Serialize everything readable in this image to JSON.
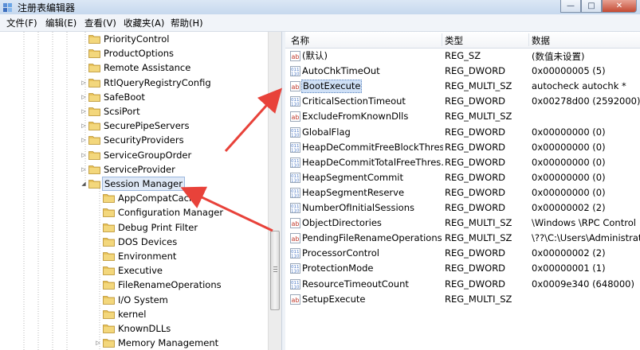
{
  "window": {
    "title": "注册表编辑器",
    "minimize": "—",
    "maximize": "□",
    "close": "✕"
  },
  "menu": [
    "文件(F)",
    "编辑(E)",
    "查看(V)",
    "收藏夹(A)",
    "帮助(H)"
  ],
  "tree": [
    {
      "label": "PriorityControl",
      "has_children": false,
      "level": 1
    },
    {
      "label": "ProductOptions",
      "has_children": false,
      "level": 1
    },
    {
      "label": "Remote Assistance",
      "has_children": false,
      "level": 1
    },
    {
      "label": "RtlQueryRegistryConfig",
      "has_children": true,
      "level": 1
    },
    {
      "label": "SafeBoot",
      "has_children": true,
      "level": 1
    },
    {
      "label": "ScsiPort",
      "has_children": true,
      "level": 1
    },
    {
      "label": "SecurePipeServers",
      "has_children": true,
      "level": 1
    },
    {
      "label": "SecurityProviders",
      "has_children": true,
      "level": 1
    },
    {
      "label": "ServiceGroupOrder",
      "has_children": true,
      "level": 1
    },
    {
      "label": "ServiceProvider",
      "has_children": true,
      "level": 1
    },
    {
      "label": "Session Manager",
      "has_children": true,
      "expanded": true,
      "selected": true,
      "level": 1
    },
    {
      "label": "AppCompatCache",
      "has_children": false,
      "level": 2
    },
    {
      "label": "Configuration Manager",
      "has_children": false,
      "level": 2
    },
    {
      "label": "Debug Print Filter",
      "has_children": false,
      "level": 2
    },
    {
      "label": "DOS Devices",
      "has_children": false,
      "level": 2
    },
    {
      "label": "Environment",
      "has_children": false,
      "level": 2
    },
    {
      "label": "Executive",
      "has_children": false,
      "level": 2
    },
    {
      "label": "FileRenameOperations",
      "has_children": false,
      "level": 2
    },
    {
      "label": "I/O System",
      "has_children": false,
      "level": 2
    },
    {
      "label": "kernel",
      "has_children": false,
      "level": 2
    },
    {
      "label": "KnownDLLs",
      "has_children": false,
      "level": 2
    },
    {
      "label": "Memory Management",
      "has_children": true,
      "level": 2
    }
  ],
  "columns": {
    "name": "名称",
    "type": "类型",
    "data": "数据"
  },
  "values": [
    {
      "name": "(默认)",
      "type": "REG_SZ",
      "data": "(数值未设置)",
      "icon": "string-value-icon"
    },
    {
      "name": "AutoChkTimeOut",
      "type": "REG_DWORD",
      "data": "0x00000005 (5)",
      "icon": "binary-value-icon"
    },
    {
      "name": "BootExecute",
      "type": "REG_MULTI_SZ",
      "data": "autocheck autochk *",
      "icon": "string-value-icon",
      "selected": true
    },
    {
      "name": "CriticalSectionTimeout",
      "type": "REG_DWORD",
      "data": "0x00278d00 (2592000)",
      "icon": "binary-value-icon"
    },
    {
      "name": "ExcludeFromKnownDlls",
      "type": "REG_MULTI_SZ",
      "data": "",
      "icon": "string-value-icon"
    },
    {
      "name": "GlobalFlag",
      "type": "REG_DWORD",
      "data": "0x00000000 (0)",
      "icon": "binary-value-icon"
    },
    {
      "name": "HeapDeCommitFreeBlockThres...",
      "type": "REG_DWORD",
      "data": "0x00000000 (0)",
      "icon": "binary-value-icon"
    },
    {
      "name": "HeapDeCommitTotalFreeThres...",
      "type": "REG_DWORD",
      "data": "0x00000000 (0)",
      "icon": "binary-value-icon"
    },
    {
      "name": "HeapSegmentCommit",
      "type": "REG_DWORD",
      "data": "0x00000000 (0)",
      "icon": "binary-value-icon"
    },
    {
      "name": "HeapSegmentReserve",
      "type": "REG_DWORD",
      "data": "0x00000000 (0)",
      "icon": "binary-value-icon"
    },
    {
      "name": "NumberOfInitialSessions",
      "type": "REG_DWORD",
      "data": "0x00000002 (2)",
      "icon": "binary-value-icon"
    },
    {
      "name": "ObjectDirectories",
      "type": "REG_MULTI_SZ",
      "data": "\\Windows \\RPC Control",
      "icon": "string-value-icon"
    },
    {
      "name": "PendingFileRenameOperations",
      "type": "REG_MULTI_SZ",
      "data": "\\??\\C:\\Users\\Administrat",
      "icon": "string-value-icon"
    },
    {
      "name": "ProcessorControl",
      "type": "REG_DWORD",
      "data": "0x00000002 (2)",
      "icon": "binary-value-icon"
    },
    {
      "name": "ProtectionMode",
      "type": "REG_DWORD",
      "data": "0x00000001 (1)",
      "icon": "binary-value-icon"
    },
    {
      "name": "ResourceTimeoutCount",
      "type": "REG_DWORD",
      "data": "0x0009e340 (648000)",
      "icon": "binary-value-icon"
    },
    {
      "name": "SetupExecute",
      "type": "REG_MULTI_SZ",
      "data": "",
      "icon": "string-value-icon"
    }
  ],
  "colors": {
    "folder": "#e8c25a",
    "selection": "#cfe0f6",
    "arrow": "#e8423a",
    "binary_icon": "#4a78c6",
    "string_icon": "#c0392b"
  }
}
